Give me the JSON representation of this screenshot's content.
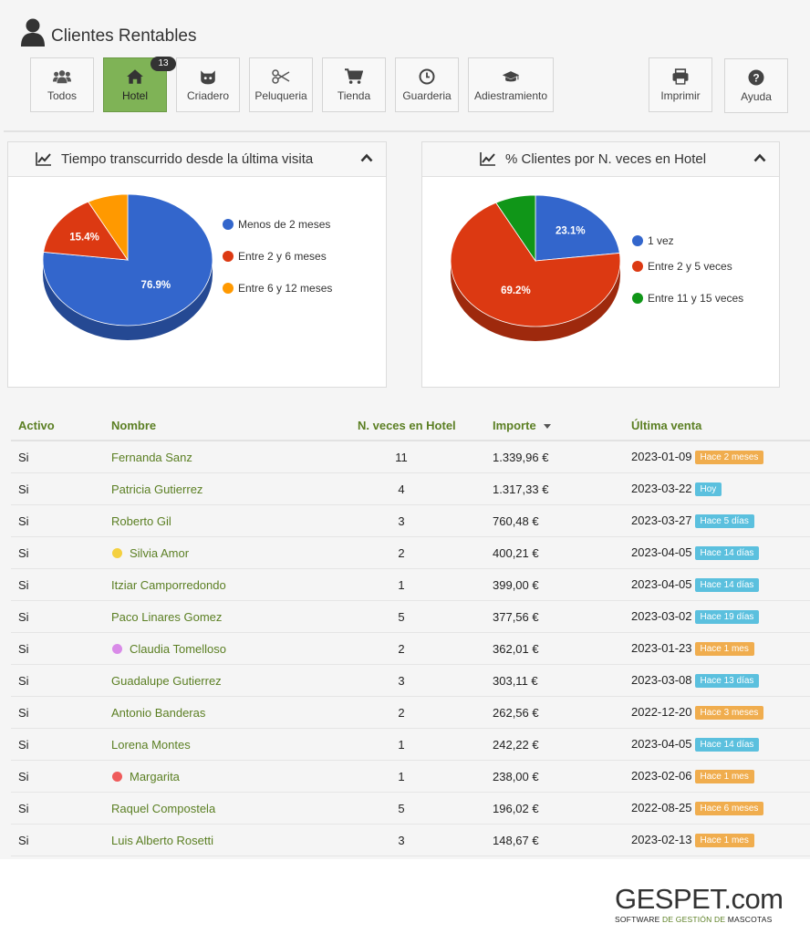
{
  "header": {
    "title": "Clientes Rentables"
  },
  "toolbar": {
    "items": [
      {
        "label": "Todos",
        "icon": "users-icon"
      },
      {
        "label": "Hotel",
        "icon": "home-icon",
        "active": true,
        "badge": "13"
      },
      {
        "label": "Criadero",
        "icon": "paw-icon"
      },
      {
        "label": "Peluqueria",
        "icon": "scissors-icon"
      },
      {
        "label": "Tienda",
        "icon": "cart-icon"
      },
      {
        "label": "Guarderia",
        "icon": "clock-icon"
      },
      {
        "label": "Adiestramiento",
        "icon": "graduation-cap-icon"
      },
      {
        "label": "Imprimir",
        "icon": "print-icon"
      },
      {
        "label": "Ayuda",
        "icon": "help-icon"
      }
    ]
  },
  "panels": [
    {
      "title": "Tiempo transcurrido desde la última visita"
    },
    {
      "title": "% Clientes por N. veces en Hotel"
    }
  ],
  "chart_data": [
    {
      "type": "pie",
      "title": "Tiempo transcurrido desde la última visita",
      "categories": [
        "Menos de 2 meses",
        "Entre 2 y 6  meses",
        "Entre 6 y 12 meses"
      ],
      "values": [
        76.9,
        15.4,
        7.7
      ],
      "value_labels": [
        "76.9%",
        "15.4%",
        ""
      ],
      "colors": [
        "#3366cc",
        "#dc3912",
        "#ff9900"
      ],
      "legend": "right"
    },
    {
      "type": "pie",
      "title": "% Clientes por N. veces en Hotel",
      "categories": [
        "1 vez",
        "Entre 2 y 5  veces",
        "Entre 11 y 15  veces"
      ],
      "values": [
        23.1,
        69.2,
        7.7
      ],
      "value_labels": [
        "23.1%",
        "69.2%",
        ""
      ],
      "colors": [
        "#3366cc",
        "#dc3912",
        "#109618"
      ],
      "legend": "right"
    }
  ],
  "table": {
    "headers": {
      "activo": "Activo",
      "nombre": "Nombre",
      "veces": "N. veces en Hotel",
      "importe": "Importe",
      "ultima": "Última venta"
    },
    "rows": [
      {
        "activo": "Si",
        "nombre": "Fernanda Sanz",
        "veces": "11",
        "importe": "1.339,96 €",
        "fecha": "2023-01-09",
        "tag": "Hace 2 meses",
        "tag_color": "#f0ad4e"
      },
      {
        "activo": "Si",
        "nombre": "Patricia Gutierrez",
        "veces": "4",
        "importe": "1.317,33 €",
        "fecha": "2023-03-22",
        "tag": "Hoy",
        "tag_color": "#5bc0de"
      },
      {
        "activo": "Si",
        "nombre": "Roberto Gil",
        "veces": "3",
        "importe": "760,48 €",
        "fecha": "2023-03-27",
        "tag": "Hace 5 días",
        "tag_color": "#5bc0de"
      },
      {
        "activo": "Si",
        "nombre": "Silvia Amor",
        "mark": "#f4d03f",
        "veces": "2",
        "importe": "400,21 €",
        "fecha": "2023-04-05",
        "tag": "Hace 14 días",
        "tag_color": "#5bc0de"
      },
      {
        "activo": "Si",
        "nombre": "Itziar Camporredondo",
        "veces": "1",
        "importe": "399,00 €",
        "fecha": "2023-04-05",
        "tag": "Hace 14 días",
        "tag_color": "#5bc0de"
      },
      {
        "activo": "Si",
        "nombre": "Paco Linares Gomez",
        "veces": "5",
        "importe": "377,56 €",
        "fecha": "2023-03-02",
        "tag": "Hace 19 días",
        "tag_color": "#5bc0de"
      },
      {
        "activo": "Si",
        "nombre": "Claudia Tomelloso",
        "mark": "#d98be8",
        "veces": "2",
        "importe": "362,01 €",
        "fecha": "2023-01-23",
        "tag": "Hace 1 mes",
        "tag_color": "#f0ad4e"
      },
      {
        "activo": "Si",
        "nombre": "Guadalupe Gutierrez",
        "veces": "3",
        "importe": "303,11 €",
        "fecha": "2023-03-08",
        "tag": "Hace 13 días",
        "tag_color": "#5bc0de"
      },
      {
        "activo": "Si",
        "nombre": "Antonio Banderas",
        "veces": "2",
        "importe": "262,56 €",
        "fecha": "2022-12-20",
        "tag": "Hace 3 meses",
        "tag_color": "#f0ad4e"
      },
      {
        "activo": "Si",
        "nombre": "Lorena Montes",
        "veces": "1",
        "importe": "242,22 €",
        "fecha": "2023-04-05",
        "tag": "Hace 14 días",
        "tag_color": "#5bc0de"
      },
      {
        "activo": "Si",
        "nombre": "Margarita",
        "mark": "#ef5b5b",
        "veces": "1",
        "importe": "238,00 €",
        "fecha": "2023-02-06",
        "tag": "Hace 1 mes",
        "tag_color": "#f0ad4e"
      },
      {
        "activo": "Si",
        "nombre": "Raquel Compostela",
        "veces": "5",
        "importe": "196,02 €",
        "fecha": "2022-08-25",
        "tag": "Hace 6 meses",
        "tag_color": "#f0ad4e"
      },
      {
        "activo": "Si",
        "nombre": "Luis Alberto Rosetti",
        "veces": "3",
        "importe": "148,67 €",
        "fecha": "2023-02-13",
        "tag": "Hace 1 mes",
        "tag_color": "#f0ad4e"
      }
    ]
  },
  "logo": {
    "brand_main": "GESPET",
    "brand_suffix": ".com",
    "tagline_a": "SOFTWARE ",
    "tagline_b": "DE GESTIÓN DE ",
    "tagline_c": "MASCOTAS"
  }
}
